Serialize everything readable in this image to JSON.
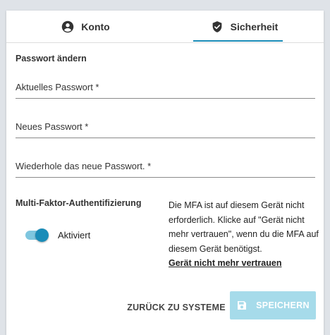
{
  "tabs": {
    "konto": {
      "label": "Konto",
      "icon": "account-circle-icon"
    },
    "sicherheit": {
      "label": "Sicherheit",
      "icon": "shield-check-icon",
      "active": true
    }
  },
  "password": {
    "section_title": "Passwort ändern",
    "current_placeholder": "Aktuelles Passwort *",
    "new_placeholder": "Neues Passwort *",
    "repeat_placeholder": "Wiederhole das neue Passwort. *"
  },
  "mfa": {
    "title": "Multi-Faktor-Authentifizierung",
    "toggle_label": "Aktiviert",
    "toggle_on": true,
    "info": "Die MFA ist auf diesem Gerät nicht erforderlich. Klicke auf \"Gerät nicht mehr vertrauen\", wenn du die MFA auf diesem Gerät benötigst.",
    "untrust_link": "Gerät nicht mehr vertrauen"
  },
  "actions": {
    "back_label": "ZURÜCK ZU SYSTEME",
    "save_label": "SPEICHERN",
    "save_icon": "save-icon",
    "save_disabled": true
  },
  "colors": {
    "accent": "#1a8cb8",
    "save_button_disabled": "#a6dbea",
    "background": "#dfe3e8"
  }
}
